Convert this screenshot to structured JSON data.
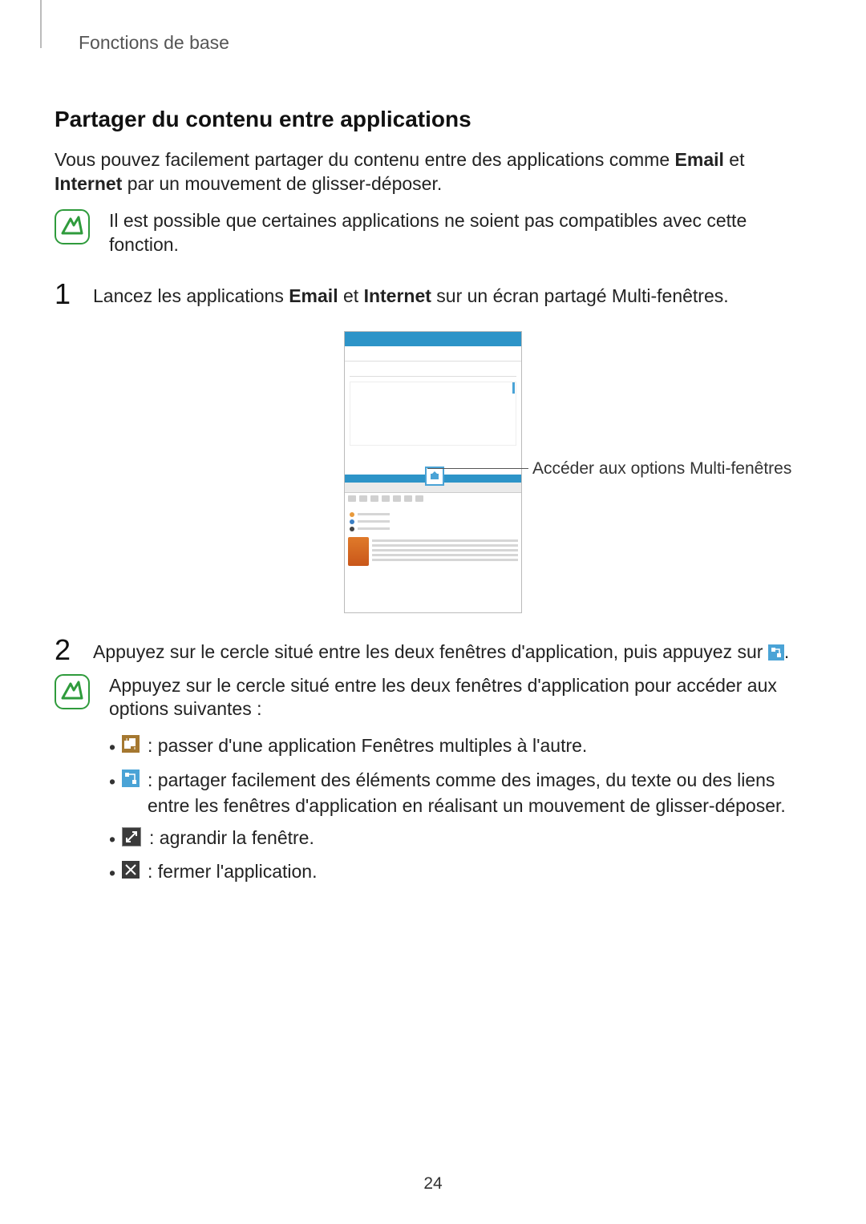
{
  "header": "Fonctions de base",
  "title": "Partager du contenu entre applications",
  "intro_pre": "Vous pouvez facilement partager du contenu entre des applications comme ",
  "intro_bold1": "Email",
  "intro_mid": " et ",
  "intro_bold2": "Internet",
  "intro_post": " par un mouvement de glisser-déposer.",
  "compat_note": "Il est possible que certaines applications ne soient pas compatibles avec cette fonction.",
  "step1": {
    "num": "1",
    "pre": "Lancez les applications ",
    "b1": "Email",
    "mid": " et ",
    "b2": "Internet",
    "post": " sur un écran partagé Multi-fenêtres."
  },
  "callout": "Accéder aux options Multi-fenêtres",
  "step2": {
    "num": "2",
    "pre": "Appuyez sur le cercle situé entre les deux fenêtres d'application, puis appuyez sur ",
    "post": "."
  },
  "options_note": "Appuyez sur le cercle situé entre les deux fenêtres d'application pour accéder aux options suivantes :",
  "bullets": {
    "swap": " : passer d'une application Fenêtres multiples à l'autre.",
    "share": " : partager facilement des éléments comme des images, du texte ou des liens entre les fenêtres d'application en réalisant un mouvement de glisser-déposer.",
    "maximize": " : agrandir la fenêtre.",
    "close": " : fermer l'application."
  },
  "page_number": "24"
}
